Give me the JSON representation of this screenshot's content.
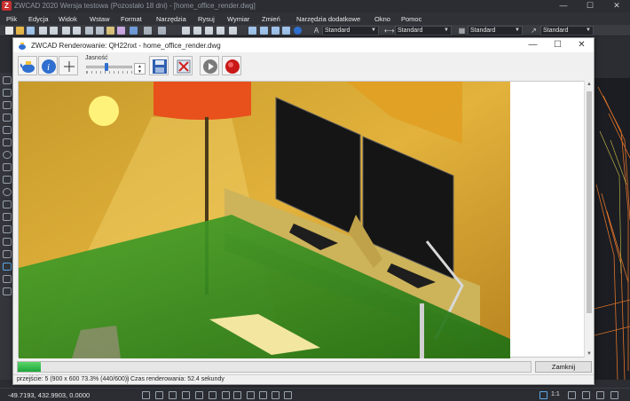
{
  "app": {
    "title": "ZWCAD 2020 Wersja testowa (Pozostało 18 dni) - [home_office_render.dwg]",
    "logo_letter": "Z",
    "minimize": "—",
    "maximize": "☐",
    "close": "✕"
  },
  "menu": [
    "Plik",
    "Edycja",
    "Widok",
    "Wstaw",
    "Format",
    "Narzędzia",
    "Rysuj",
    "Wymiar",
    "Zmień",
    "Narzędzia dodatkowe",
    "Okno",
    "Pomoc"
  ],
  "toolbar": {
    "style_combos": [
      "Standard",
      "Standard",
      "Standard",
      "Standard"
    ],
    "combo_arrow": "▼"
  },
  "dialog": {
    "title": "ZWCAD Renderowanie: QH22nxt - home_office_render.dwg",
    "minimize": "—",
    "maximize": "☐",
    "close": "✕",
    "brightness_label": "Jasność",
    "spin_up": "▲",
    "spin_down": "▼",
    "scroll_up": "▲",
    "scroll_down": "▼",
    "progress": 0.045,
    "close_button": "Zamknij",
    "status_pass": "przejście: 5 (900 x 600 73.3% (440/600))",
    "status_time": "Czas renderowania: 52.4 sekundy"
  },
  "statusbar": {
    "coords": "-49.7193, 432.9903, 0.0000",
    "scale": "1:1"
  },
  "colors": {
    "accent_blue": "#2f6fd0",
    "render_wall": "#d9a93a",
    "render_desk_green": "#2f8f1e",
    "lamp_red": "#e8501c",
    "progress_green": "#2eb94a"
  }
}
